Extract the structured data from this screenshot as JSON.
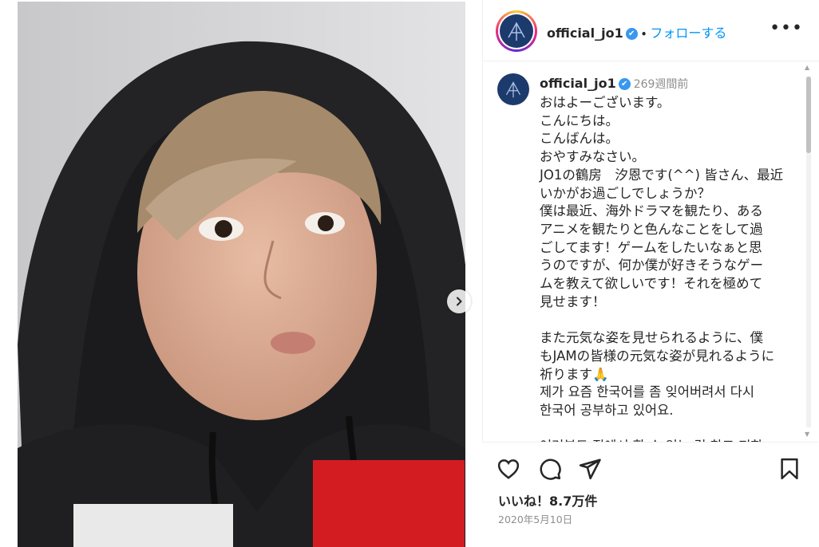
{
  "post": {
    "username": "official_jo1",
    "verified_mark": "✔",
    "dot": "•",
    "follow_label": "フォローする",
    "more_label": "•••",
    "time_ago": "269週間前",
    "caption": "おはよーございます。\nこんにちは。\nこんばんは。\nおやすみなさい。\nJO1の鶴房　汐恩です(^^) 皆さん、最近\nいかがお過ごしでしょうか？\n僕は最近、海外ドラマを観たり、ある\nアニメを観たりと色んなことをして過\nごしてます！ゲームをしたいなぁと思\nうのですが、何か僕が好きそうなゲー\nムを教えて欲しいです！それを極めて\n見せます！\n\nまた元気な姿を見せられるように、僕\nもJAMの皆様の元気な姿が見れるように\n祈ります🙏\n제가 요즘 한국어를 좀 잊어버려서 다시\n한국어 공부하고 있어요.\n\n여러분도 집에서 할 수 있는 걸 찾고 저한",
    "likes_label": "いいね！8.7万件",
    "date": "2020年5月10日"
  },
  "icons": {
    "next": "chevron-right-icon",
    "like": "heart-icon",
    "comment": "comment-icon",
    "share": "paper-plane-icon",
    "save": "bookmark-icon"
  },
  "colors": {
    "follow": "#0095f6",
    "verified": "#3897f0",
    "avatar_bg": "#1d3a6d"
  }
}
